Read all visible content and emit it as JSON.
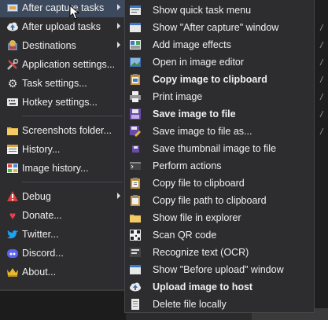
{
  "main_menu": {
    "items": [
      {
        "label": "After capture tasks",
        "icon": "after-capture-icon",
        "has_submenu": true,
        "highlighted": true
      },
      {
        "label": "After upload tasks",
        "icon": "cloud-upload-icon",
        "has_submenu": true
      },
      {
        "label": "Destinations",
        "icon": "destinations-icon",
        "has_submenu": true
      },
      {
        "label": "Application settings...",
        "icon": "wrench-screwdriver-icon"
      },
      {
        "label": "Task settings...",
        "icon": "gear-icon"
      },
      {
        "label": "Hotkey settings...",
        "icon": "keyboard-icon"
      },
      {
        "label": "Screenshots folder...",
        "icon": "folder-icon"
      },
      {
        "label": "History...",
        "icon": "history-icon"
      },
      {
        "label": "Image history...",
        "icon": "image-history-icon"
      },
      {
        "label": "Debug",
        "icon": "debug-icon",
        "has_submenu": true
      },
      {
        "label": "Donate...",
        "icon": "heart-icon"
      },
      {
        "label": "Twitter...",
        "icon": "twitter-icon"
      },
      {
        "label": "Discord...",
        "icon": "discord-icon"
      },
      {
        "label": "About...",
        "icon": "crown-icon"
      }
    ]
  },
  "sub_menu": {
    "items": [
      {
        "label": "Show quick task menu",
        "icon": "quick-task-icon",
        "bold": false
      },
      {
        "label": "Show \"After capture\" window",
        "icon": "window-icon",
        "bold": false
      },
      {
        "label": "Add image effects",
        "icon": "image-effects-icon",
        "bold": false
      },
      {
        "label": "Open in image editor",
        "icon": "image-editor-icon",
        "bold": false
      },
      {
        "label": "Copy image to clipboard",
        "icon": "clipboard-image-icon",
        "bold": true
      },
      {
        "label": "Print image",
        "icon": "printer-icon",
        "bold": false
      },
      {
        "label": "Save image to file",
        "icon": "save-icon",
        "bold": true
      },
      {
        "label": "Save image to file as...",
        "icon": "save-as-icon",
        "bold": false
      },
      {
        "label": "Save thumbnail image to file",
        "icon": "save-thumbnail-icon",
        "bold": false
      },
      {
        "label": "Perform actions",
        "icon": "actions-icon",
        "bold": false
      },
      {
        "label": "Copy file to clipboard",
        "icon": "copy-file-icon",
        "bold": false
      },
      {
        "label": "Copy file path to clipboard",
        "icon": "copy-path-icon",
        "bold": false
      },
      {
        "label": "Show file in explorer",
        "icon": "explorer-folder-icon",
        "bold": false
      },
      {
        "label": "Scan QR code",
        "icon": "qr-code-icon",
        "bold": false
      },
      {
        "label": "Recognize text (OCR)",
        "icon": "ocr-icon",
        "bold": false
      },
      {
        "label": "Show \"Before upload\" window",
        "icon": "before-upload-window-icon",
        "bold": false
      },
      {
        "label": "Upload image to host",
        "icon": "cloud-upload-icon",
        "bold": true
      },
      {
        "label": "Delete file locally",
        "icon": "delete-file-icon",
        "bold": false
      }
    ]
  },
  "colors": {
    "menu_bg": "#2d2d30",
    "highlight": "#3d4a5e",
    "text": "#f0f0f0"
  }
}
